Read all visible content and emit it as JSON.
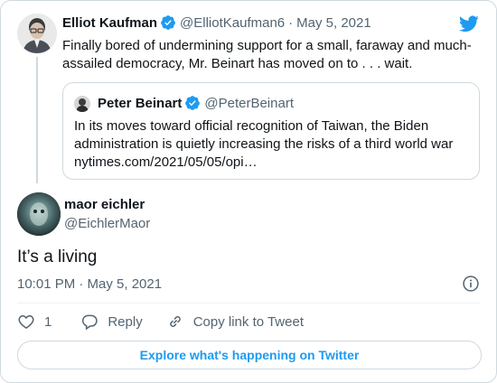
{
  "parent_tweet": {
    "author_name": "Elliot Kaufman",
    "handle": "@ElliotKaufman6",
    "separator": "·",
    "date": "May 5, 2021",
    "text": "Finally bored of undermining support for a small, faraway and much-assailed democracy, Mr. Beinart has moved on to . . . wait."
  },
  "quoted_tweet": {
    "author_name": "Peter Beinart",
    "handle": "@PeterBeinart",
    "text": "In its moves toward official recognition of Taiwan, the Biden administration is quietly increasing the risks of a third world war nytimes.com/2021/05/05/opi…"
  },
  "main_tweet": {
    "author_name": "maor eichler",
    "handle": "@EichlerMaor",
    "text": "It’s a living",
    "timestamp": "10:01 PM · May 5, 2021"
  },
  "actions": {
    "like_count": "1",
    "reply_label": "Reply",
    "copy_link_label": "Copy link to Tweet"
  },
  "cta": {
    "label": "Explore what's happening on Twitter"
  },
  "colors": {
    "brand": "#1d9bf0",
    "text": "#0f1419",
    "muted": "#536471",
    "border": "#cfd9de"
  },
  "icons": [
    "verified-badge-icon",
    "twitter-bird-icon",
    "info-icon",
    "heart-icon",
    "reply-icon",
    "link-icon"
  ]
}
